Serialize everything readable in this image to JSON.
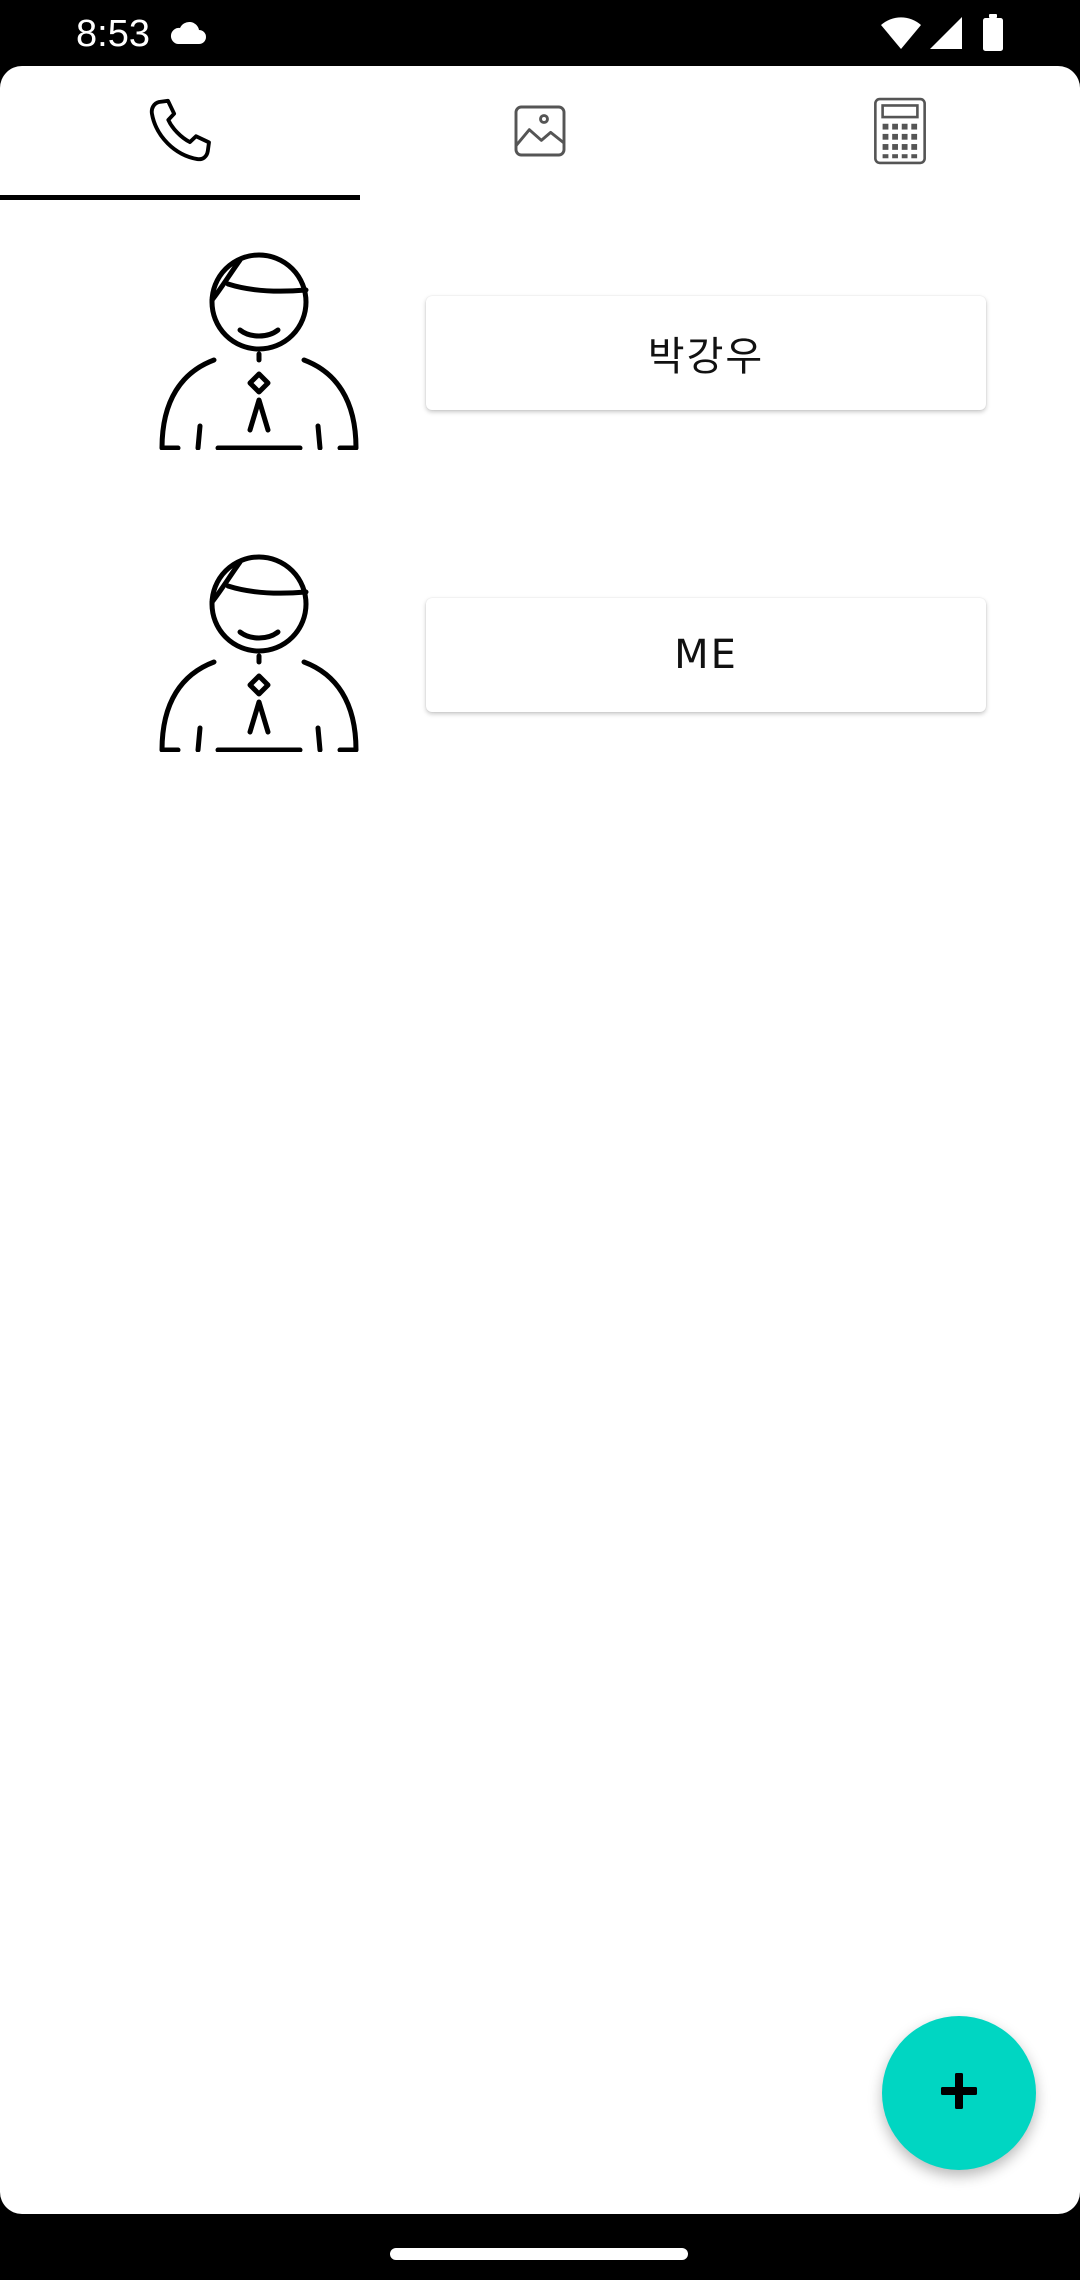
{
  "status_bar": {
    "time": "8:53",
    "icons": [
      "cloud-icon",
      "wifi-icon",
      "signal-icon",
      "battery-icon"
    ]
  },
  "tabs": [
    {
      "icon": "phone-icon",
      "selected": true
    },
    {
      "icon": "image-icon",
      "selected": false
    },
    {
      "icon": "calculator-icon",
      "selected": false
    }
  ],
  "contacts": [
    {
      "name": "박강우",
      "avatar": "person-avatar-icon"
    },
    {
      "name": "ME",
      "avatar": "person-avatar-icon"
    }
  ],
  "fab": {
    "icon": "plus-icon"
  },
  "colors": {
    "accent": "#00d6c2",
    "tab_indicator": "#000000",
    "background": "#ffffff"
  }
}
